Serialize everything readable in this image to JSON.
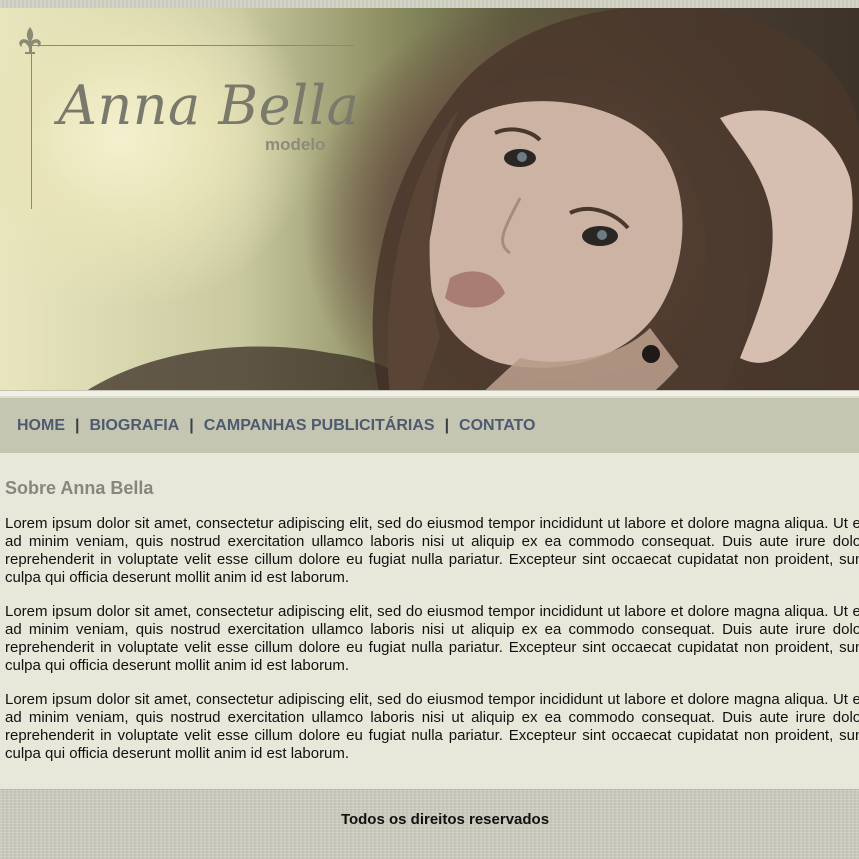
{
  "banner": {
    "logo_name": "Anna Bella",
    "logo_subtitle": "modelo"
  },
  "nav": {
    "items": [
      {
        "label": "HOME"
      },
      {
        "label": "BIOGRAFIA"
      },
      {
        "label": "CAMPANHAS PUBLICITÁRIAS"
      },
      {
        "label": "CONTATO"
      }
    ],
    "separator": "|"
  },
  "main": {
    "heading": "Sobre Anna Bella",
    "paragraphs": [
      "Lorem ipsum dolor sit amet, consectetur adipiscing elit, sed do eiusmod tempor incididunt ut labore et dolore magna aliqua. Ut enim ad minim veniam, quis nostrud exercitation ullamco laboris nisi ut aliquip ex ea commodo consequat. Duis aute irure dolor in reprehenderit in voluptate velit esse cillum dolore eu fugiat nulla pariatur. Excepteur sint occaecat cupidatat non proident, sunt in culpa qui officia deserunt mollit anim id est laborum.",
      "Lorem ipsum dolor sit amet, consectetur adipiscing elit, sed do eiusmod tempor incididunt ut labore et dolore magna aliqua. Ut enim ad minim veniam, quis nostrud exercitation ullamco laboris nisi ut aliquip ex ea commodo consequat. Duis aute irure dolor in reprehenderit in voluptate velit esse cillum dolore eu fugiat nulla pariatur. Excepteur sint occaecat cupidatat non proident, sunt in culpa qui officia deserunt mollit anim id est laborum.",
      "Lorem ipsum dolor sit amet, consectetur adipiscing elit, sed do eiusmod tempor incididunt ut labore et dolore magna aliqua. Ut enim ad minim veniam, quis nostrud exercitation ullamco laboris nisi ut aliquip ex ea commodo consequat. Duis aute irure dolor in reprehenderit in voluptate velit esse cillum dolore eu fugiat nulla pariatur. Excepteur sint occaecat cupidatat non proident, sunt in culpa qui officia deserunt mollit anim id est laborum."
    ]
  },
  "footer": {
    "text": "Todos os direitos reservados"
  },
  "colors": {
    "nav_bg": "#c5c6b2",
    "nav_text": "#4d5a70",
    "content_bg": "#e7e8d9",
    "heading": "#87877b"
  }
}
